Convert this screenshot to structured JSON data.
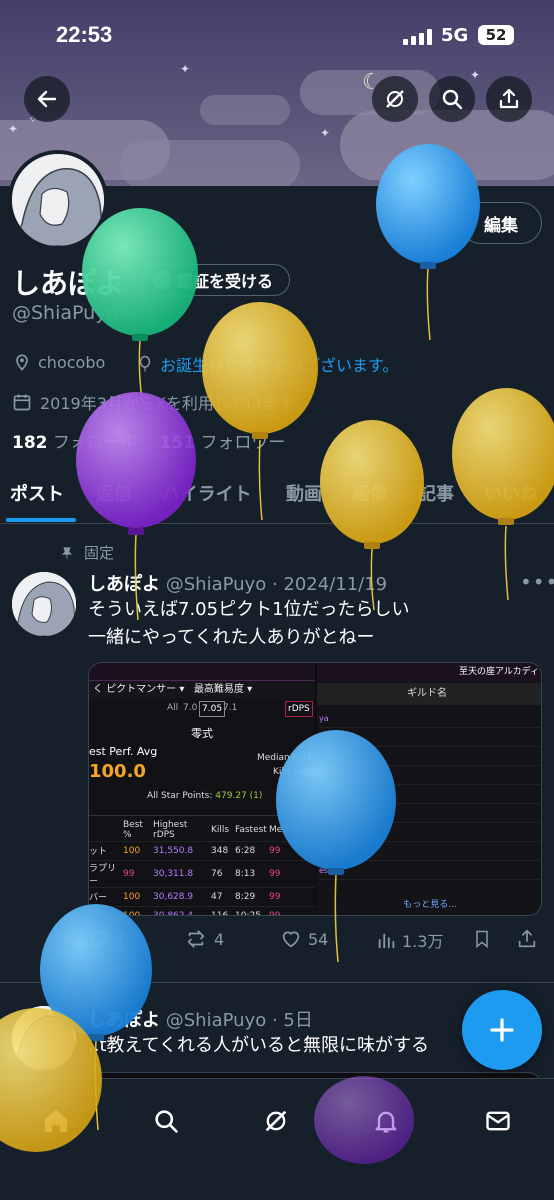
{
  "status": {
    "time": "22:53",
    "network": "5G",
    "battery": "52"
  },
  "profile": {
    "name": "しあぽよ",
    "handle": "@ShiaPuyo",
    "verify_label": "認証を受ける",
    "edit_label": "編集",
    "location": "chocobo",
    "birthday_text": "お誕生日おめでとうございます。",
    "joined": "2019年3月からXを利用しています",
    "following_count": "182",
    "following_label": "フォロー中",
    "followers_count": "151",
    "followers_label": "フォロワー"
  },
  "tabs": [
    "ポスト",
    "返信",
    "ハイライト",
    "動画",
    "画像",
    "記事",
    "いいね"
  ],
  "pinned_label": "固定",
  "post1": {
    "name": "しあぽよ",
    "handle": "@ShiaPuyo",
    "date": "2024/11/19",
    "line1": "そういえば7.05ピクト1位だったらしい",
    "line2": "一緒にやってくれた人ありがとねー",
    "replies": "1",
    "reposts": "4",
    "likes": "54",
    "views": "1.3万"
  },
  "media": {
    "header_title": "至天の座アルカディ",
    "filter_job": "ピクトマンサー ▾",
    "filter_diff": "最高難易度 ▾",
    "version_all": "All",
    "version_70": "7.0",
    "version_705": "7.05",
    "version_71": "7.1",
    "metric": "rDPS",
    "zone": "零式",
    "best_perf_label": "est Perf. Avg",
    "best_perf_value": "100.0",
    "median_label": "Median Perf. Avg",
    "kills_label": "Kills Logged",
    "allstar_label": "All Star Points:",
    "allstar_value": "479.27 (1)",
    "columns": [
      "Best %",
      "Highest rDPS",
      "Kills",
      "Fastest",
      "Med"
    ],
    "rows": [
      [
        "ット",
        "100",
        "31,550.8",
        "348",
        "6:28",
        "99"
      ],
      [
        "ラプリー",
        "99",
        "30,311.8",
        "76",
        "8:13",
        "99"
      ],
      [
        "バー",
        "100",
        "30,628.9",
        "47",
        "8:29",
        "99"
      ],
      [
        "ンダー",
        "100",
        "30,862.4",
        "116",
        "10:25",
        "99"
      ]
    ],
    "right_header": "ギルド名",
    "right_rows": [
      "ya",
      "",
      "",
      "",
      "",
      "",
      "",
      "ma",
      "es"
    ],
    "right_more": "もっと見る..."
  },
  "post2": {
    "name": "しあぽよ",
    "handle": "@ShiaPuyo",
    "date": "5日",
    "line1": "..t教えてくれる人がいると無限に味がする"
  },
  "colors": {
    "accent": "#1d9bf0",
    "background": "#15202b",
    "muted": "#8b98a5"
  },
  "nav": [
    "home-icon",
    "search-icon",
    "grok-icon",
    "notifications-icon",
    "messages-icon"
  ]
}
